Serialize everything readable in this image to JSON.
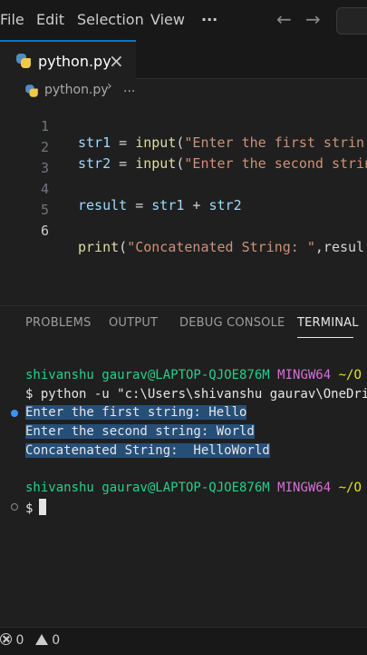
{
  "menu": {
    "file": "File",
    "edit": "Edit",
    "selection": "Selection",
    "view": "View",
    "more": "···"
  },
  "nav": {
    "back_icon": "arrow-left-icon",
    "forward_icon": "arrow-right-icon"
  },
  "tab": {
    "label": "python.py",
    "close": "×"
  },
  "breadcrumb": {
    "file": "python.py",
    "separator": "›",
    "more": "..."
  },
  "code": {
    "lines": [
      {
        "num": "1",
        "a": "str1",
        "b": " = ",
        "c": "input",
        "d": "(",
        "e": "\"Enter the first strin"
      },
      {
        "num": "2",
        "a": "str2",
        "b": " = ",
        "c": "input",
        "d": "(",
        "e": "\"Enter the second strin"
      },
      {
        "num": "3"
      },
      {
        "num": "4",
        "a": "result",
        "b": " = ",
        "c": "str1",
        "d": " + ",
        "e": "str2"
      },
      {
        "num": "5"
      },
      {
        "num": "6",
        "a": "print",
        "b": "(",
        "c": "\"Concatenated String: \"",
        "d": ",resul"
      }
    ]
  },
  "panel": {
    "tabs": [
      "PROBLEMS",
      "OUTPUT",
      "DEBUG CONSOLE",
      "TERMINAL"
    ],
    "active_tab": "TERMINAL"
  },
  "terminal": {
    "prompt_user": "shivanshu gaurav@LAPTOP-QJOE876M",
    "prompt_env": "MINGW64",
    "prompt_path": "~/O",
    "command": "$ python -u \"c:\\Users\\shivanshu gaurav\\OneDri",
    "output": [
      "Enter the first string: Hello",
      "Enter the second string: World",
      "Concatenated String:  HelloWorld"
    ],
    "prompt2_user": "shivanshu gaurav@LAPTOP-QJOE876M",
    "prompt2_env": "MINGW64",
    "prompt2_path": "~/O",
    "cursor_prompt": "$"
  },
  "status": {
    "errors": "0",
    "warnings": "0"
  },
  "colors": {
    "accent": "#0078d4",
    "prompt_green": "#23d18b",
    "prompt_magenta": "#d670d6",
    "prompt_yellow": "#e5e510",
    "selection": "#264f78"
  }
}
